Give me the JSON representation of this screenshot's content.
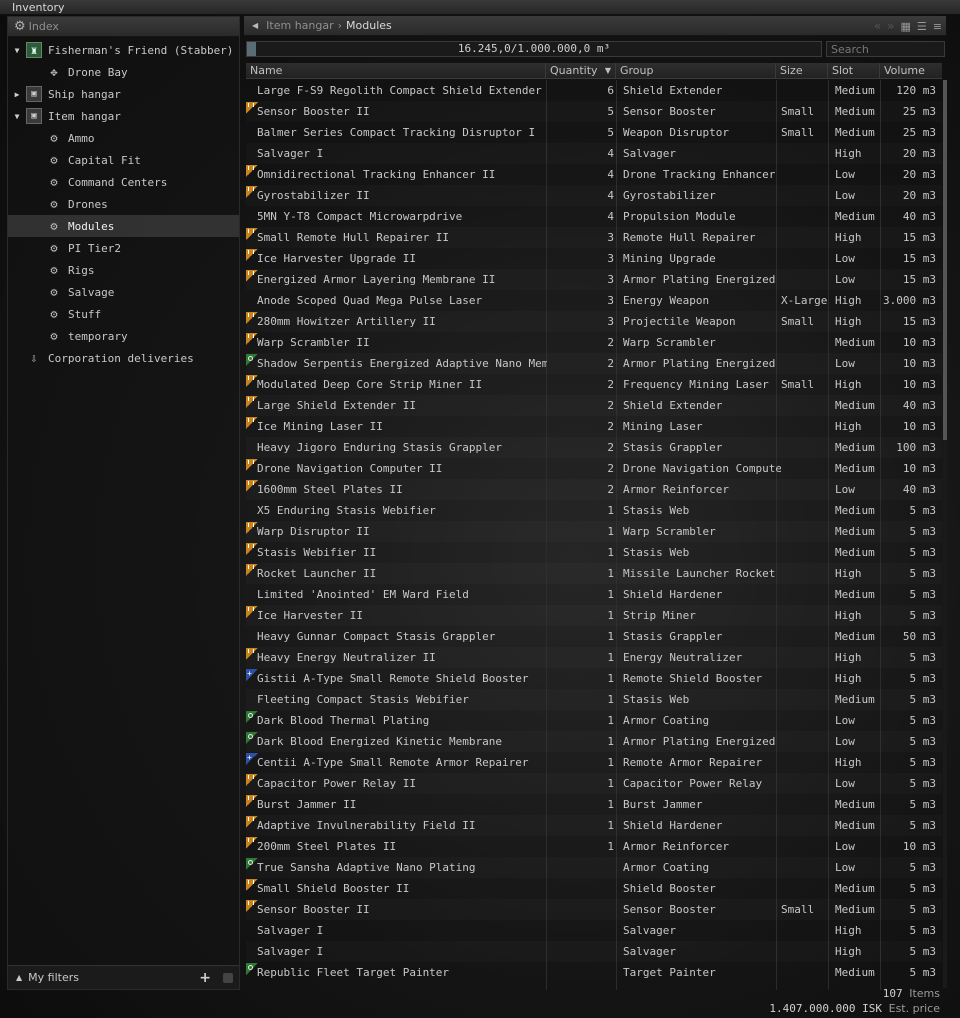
{
  "window": {
    "title": "Inventory"
  },
  "sidebar": {
    "header": "Index",
    "tree": [
      {
        "label": "Fisherman's Friend (Stabber)",
        "level": 0,
        "expanded": true,
        "icon": "ship-icon"
      },
      {
        "label": "Drone Bay",
        "level": 1,
        "icon": "drone-bay-icon"
      },
      {
        "label": "Ship hangar",
        "level": 0,
        "expanded": false,
        "icon": "ship-hangar-icon"
      },
      {
        "label": "Item hangar",
        "level": 0,
        "expanded": true,
        "icon": "item-hangar-icon"
      },
      {
        "label": "Ammo",
        "level": 1,
        "icon": "container-icon"
      },
      {
        "label": "Capital Fit",
        "level": 1,
        "icon": "container-icon"
      },
      {
        "label": "Command Centers",
        "level": 1,
        "icon": "container-icon"
      },
      {
        "label": "Drones",
        "level": 1,
        "icon": "container-icon"
      },
      {
        "label": "Modules",
        "level": 1,
        "icon": "container-icon",
        "selected": true
      },
      {
        "label": "PI Tier2",
        "level": 1,
        "icon": "container-icon"
      },
      {
        "label": "Rigs",
        "level": 1,
        "icon": "container-icon"
      },
      {
        "label": "Salvage",
        "level": 1,
        "icon": "container-icon"
      },
      {
        "label": "Stuff",
        "level": 1,
        "icon": "container-icon"
      },
      {
        "label": "temporary",
        "level": 1,
        "icon": "container-icon"
      },
      {
        "label": "Corporation deliveries",
        "level": 0,
        "icon": "corp-deliveries-icon"
      }
    ],
    "my_filters": "My filters"
  },
  "breadcrumb": {
    "parent": "Item hangar",
    "separator": "›",
    "current": "Modules"
  },
  "capacity": {
    "text": "16.245,0/1.000.000,0 m³",
    "fraction": 0.016
  },
  "search": {
    "placeholder": "Search",
    "value": ""
  },
  "columns": {
    "name": "Name",
    "quantity": "Quantity",
    "group": "Group",
    "size": "Size",
    "slot": "Slot",
    "volume": "Volume"
  },
  "items": [
    {
      "name": "Large F-S9 Regolith Compact Shield Extender",
      "qty": "6",
      "group": "Shield Extender",
      "size": "",
      "slot": "Medium",
      "volume": "120 m3",
      "badge": ""
    },
    {
      "name": "Sensor Booster II",
      "qty": "5",
      "group": "Sensor Booster",
      "size": "Small",
      "slot": "Medium",
      "volume": "25 m3",
      "badge": "t2"
    },
    {
      "name": "Balmer Series Compact Tracking Disruptor I",
      "qty": "5",
      "group": "Weapon Disruptor",
      "size": "Small",
      "slot": "Medium",
      "volume": "25 m3",
      "badge": ""
    },
    {
      "name": "Salvager I",
      "qty": "4",
      "group": "Salvager",
      "size": "",
      "slot": "High",
      "volume": "20 m3",
      "badge": ""
    },
    {
      "name": "Omnidirectional Tracking Enhancer II",
      "qty": "4",
      "group": "Drone Tracking Enhancer",
      "size": "",
      "slot": "Low",
      "volume": "20 m3",
      "badge": "t2"
    },
    {
      "name": "Gyrostabilizer II",
      "qty": "4",
      "group": "Gyrostabilizer",
      "size": "",
      "slot": "Low",
      "volume": "20 m3",
      "badge": "t2"
    },
    {
      "name": "5MN Y-T8 Compact Microwarpdrive",
      "qty": "4",
      "group": "Propulsion Module",
      "size": "",
      "slot": "Medium",
      "volume": "40 m3",
      "badge": ""
    },
    {
      "name": "Small Remote Hull Repairer II",
      "qty": "3",
      "group": "Remote Hull Repairer",
      "size": "",
      "slot": "High",
      "volume": "15 m3",
      "badge": "t2"
    },
    {
      "name": "Ice Harvester Upgrade II",
      "qty": "3",
      "group": "Mining Upgrade",
      "size": "",
      "slot": "Low",
      "volume": "15 m3",
      "badge": "t2"
    },
    {
      "name": "Energized Armor Layering Membrane II",
      "qty": "3",
      "group": "Armor Plating Energized",
      "size": "",
      "slot": "Low",
      "volume": "15 m3",
      "badge": "t2"
    },
    {
      "name": "Anode Scoped Quad Mega Pulse Laser",
      "qty": "3",
      "group": "Energy Weapon",
      "size": "X-Large",
      "slot": "High",
      "volume": "3.000 m3",
      "badge": ""
    },
    {
      "name": "280mm Howitzer Artillery II",
      "qty": "3",
      "group": "Projectile Weapon",
      "size": "Small",
      "slot": "High",
      "volume": "15 m3",
      "badge": "t2"
    },
    {
      "name": "Warp Scrambler II",
      "qty": "2",
      "group": "Warp Scrambler",
      "size": "",
      "slot": "Medium",
      "volume": "10 m3",
      "badge": "t2"
    },
    {
      "name": "Shadow Serpentis Energized Adaptive Nano Membran",
      "qty": "2",
      "group": "Armor Plating Energized",
      "size": "",
      "slot": "Low",
      "volume": "10 m3",
      "badge": "faction"
    },
    {
      "name": "Modulated Deep Core Strip Miner II",
      "qty": "2",
      "group": "Frequency Mining Laser",
      "size": "Small",
      "slot": "High",
      "volume": "10 m3",
      "badge": "t2"
    },
    {
      "name": "Large Shield Extender II",
      "qty": "2",
      "group": "Shield Extender",
      "size": "",
      "slot": "Medium",
      "volume": "40 m3",
      "badge": "t2"
    },
    {
      "name": "Ice Mining Laser II",
      "qty": "2",
      "group": "Mining Laser",
      "size": "",
      "slot": "High",
      "volume": "10 m3",
      "badge": "t2"
    },
    {
      "name": "Heavy Jigoro Enduring Stasis Grappler",
      "qty": "2",
      "group": "Stasis Grappler",
      "size": "",
      "slot": "Medium",
      "volume": "100 m3",
      "badge": ""
    },
    {
      "name": "Drone Navigation Computer II",
      "qty": "2",
      "group": "Drone Navigation Computer",
      "size": "",
      "slot": "Medium",
      "volume": "10 m3",
      "badge": "t2"
    },
    {
      "name": "1600mm Steel Plates II",
      "qty": "2",
      "group": "Armor Reinforcer",
      "size": "",
      "slot": "Low",
      "volume": "40 m3",
      "badge": "t2"
    },
    {
      "name": "X5 Enduring Stasis Webifier",
      "qty": "1",
      "group": "Stasis Web",
      "size": "",
      "slot": "Medium",
      "volume": "5 m3",
      "badge": ""
    },
    {
      "name": "Warp Disruptor II",
      "qty": "1",
      "group": "Warp Scrambler",
      "size": "",
      "slot": "Medium",
      "volume": "5 m3",
      "badge": "t2"
    },
    {
      "name": "Stasis Webifier II",
      "qty": "1",
      "group": "Stasis Web",
      "size": "",
      "slot": "Medium",
      "volume": "5 m3",
      "badge": "t2"
    },
    {
      "name": "Rocket Launcher II",
      "qty": "1",
      "group": "Missile Launcher Rocket",
      "size": "",
      "slot": "High",
      "volume": "5 m3",
      "badge": "t2"
    },
    {
      "name": "Limited 'Anointed' EM Ward Field",
      "qty": "1",
      "group": "Shield Hardener",
      "size": "",
      "slot": "Medium",
      "volume": "5 m3",
      "badge": ""
    },
    {
      "name": "Ice Harvester II",
      "qty": "1",
      "group": "Strip Miner",
      "size": "",
      "slot": "High",
      "volume": "5 m3",
      "badge": "t2"
    },
    {
      "name": "Heavy Gunnar Compact Stasis Grappler",
      "qty": "1",
      "group": "Stasis Grappler",
      "size": "",
      "slot": "Medium",
      "volume": "50 m3",
      "badge": ""
    },
    {
      "name": "Heavy Energy Neutralizer II",
      "qty": "1",
      "group": "Energy Neutralizer",
      "size": "",
      "slot": "High",
      "volume": "5 m3",
      "badge": "t2"
    },
    {
      "name": "Gistii A-Type Small Remote Shield Booster",
      "qty": "1",
      "group": "Remote Shield Booster",
      "size": "",
      "slot": "High",
      "volume": "5 m3",
      "badge": "deadspace"
    },
    {
      "name": "Fleeting Compact Stasis Webifier",
      "qty": "1",
      "group": "Stasis Web",
      "size": "",
      "slot": "Medium",
      "volume": "5 m3",
      "badge": ""
    },
    {
      "name": "Dark Blood Thermal Plating",
      "qty": "1",
      "group": "Armor Coating",
      "size": "",
      "slot": "Low",
      "volume": "5 m3",
      "badge": "faction"
    },
    {
      "name": "Dark Blood Energized Kinetic Membrane",
      "qty": "1",
      "group": "Armor Plating Energized",
      "size": "",
      "slot": "Low",
      "volume": "5 m3",
      "badge": "faction"
    },
    {
      "name": "Centii A-Type Small Remote Armor Repairer",
      "qty": "1",
      "group": "Remote Armor Repairer",
      "size": "",
      "slot": "High",
      "volume": "5 m3",
      "badge": "deadspace"
    },
    {
      "name": "Capacitor Power Relay II",
      "qty": "1",
      "group": "Capacitor Power Relay",
      "size": "",
      "slot": "Low",
      "volume": "5 m3",
      "badge": "t2"
    },
    {
      "name": "Burst Jammer II",
      "qty": "1",
      "group": "Burst Jammer",
      "size": "",
      "slot": "Medium",
      "volume": "5 m3",
      "badge": "t2"
    },
    {
      "name": "Adaptive Invulnerability Field II",
      "qty": "1",
      "group": "Shield Hardener",
      "size": "",
      "slot": "Medium",
      "volume": "5 m3",
      "badge": "t2"
    },
    {
      "name": "200mm Steel Plates II",
      "qty": "1",
      "group": "Armor Reinforcer",
      "size": "",
      "slot": "Low",
      "volume": "10 m3",
      "badge": "t2"
    },
    {
      "name": "True Sansha Adaptive Nano Plating",
      "qty": "",
      "group": "Armor Coating",
      "size": "",
      "slot": "Low",
      "volume": "5 m3",
      "badge": "faction"
    },
    {
      "name": "Small Shield Booster II",
      "qty": "",
      "group": "Shield Booster",
      "size": "",
      "slot": "Medium",
      "volume": "5 m3",
      "badge": "t2"
    },
    {
      "name": "Sensor Booster II",
      "qty": "",
      "group": "Sensor Booster",
      "size": "Small",
      "slot": "Medium",
      "volume": "5 m3",
      "badge": "t2"
    },
    {
      "name": "Salvager I",
      "qty": "",
      "group": "Salvager",
      "size": "",
      "slot": "High",
      "volume": "5 m3",
      "badge": ""
    },
    {
      "name": "Salvager I",
      "qty": "",
      "group": "Salvager",
      "size": "",
      "slot": "High",
      "volume": "5 m3",
      "badge": ""
    },
    {
      "name": "Republic Fleet Target Painter",
      "qty": "",
      "group": "Target Painter",
      "size": "",
      "slot": "Medium",
      "volume": "5 m3",
      "badge": "faction"
    }
  ],
  "footer": {
    "item_count": "107",
    "items_label": "Items",
    "price_value": "1.407.000.000 ISK",
    "price_label": "Est. price"
  }
}
